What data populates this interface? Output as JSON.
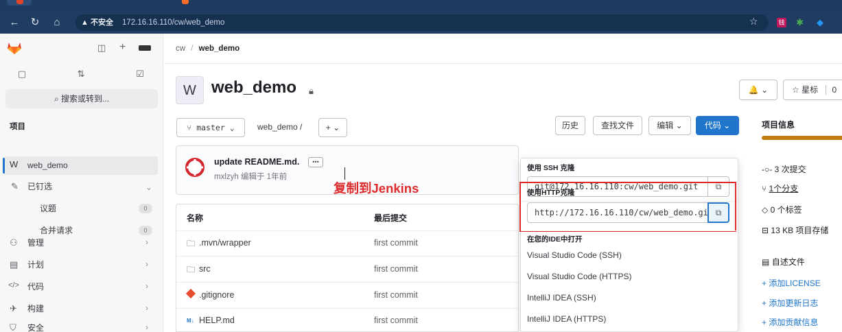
{
  "browser": {
    "warning": "▲ 不安全",
    "url": "172.16.16.110/cw/web_demo",
    "ext1": "钱"
  },
  "sidebar": {
    "search_label": "搜索或转到...",
    "section_heading": "项目",
    "project_badge": "W",
    "project_name": "web_demo",
    "items": [
      {
        "label": "已钉选"
      },
      {
        "label": "议题",
        "count": "0"
      },
      {
        "label": "合并请求",
        "count": "0"
      },
      {
        "label": "管理"
      },
      {
        "label": "计划"
      },
      {
        "label": "代码"
      },
      {
        "label": "构建"
      },
      {
        "label": "安全"
      }
    ]
  },
  "breadcrumb": {
    "group": "cw",
    "project": "web_demo"
  },
  "project": {
    "avatar_letter": "W",
    "name": "web_demo",
    "notify_label": "🔔 ⌄",
    "star_label": "☆ 星标",
    "star_count": "0"
  },
  "toolbar": {
    "branch": "master",
    "path": "web_demo /",
    "add_label": "+",
    "history": "历史",
    "find_file": "查找文件",
    "edit": "编辑",
    "code": "代码"
  },
  "commit": {
    "message": "update README.md.",
    "ellipsis": "•••",
    "author_meta": "mxlzyh 编辑于 1年前"
  },
  "annotation_text": "复制到Jenkins",
  "file_table": {
    "headers": [
      "名称",
      "最后提交"
    ],
    "rows": [
      {
        "name": ".mvn/wrapper",
        "commit": "first commit",
        "icon": "folder-icon"
      },
      {
        "name": "src",
        "commit": "first commit",
        "icon": "folder-icon"
      },
      {
        "name": ".gitignore",
        "commit": "first commit",
        "icon": "git-icon"
      },
      {
        "name": "HELP.md",
        "commit": "first commit",
        "icon": "markdown-icon"
      }
    ]
  },
  "clone_dropdown": {
    "ssh_label": "使用 SSH 克隆",
    "ssh_url": "git@172.16.16.110:cw/web_demo.git",
    "http_label": "使用HTTP克隆",
    "http_url": "http://172.16.16.110/cw/web_demo.git",
    "ide_label": "在您的IDE中打开",
    "ide_items": [
      "Visual Studio Code (SSH)",
      "Visual Studio Code (HTTPS)",
      "IntelliJ IDEA (SSH)",
      "IntelliJ IDEA (HTTPS)"
    ]
  },
  "right_panel": {
    "title": "项目信息",
    "commits": "3 次提交",
    "branches": "1个分支",
    "tags": "0 个标签",
    "storage": "13 KB 项目存储",
    "readme": "自述文件",
    "add_license": "添加LICENSE",
    "add_changelog": "添加更新日志",
    "add_contributing": "添加贡献信息"
  },
  "colors": {
    "accent": "#1f75cb",
    "annotation": "#dd2b2b",
    "language_bar": "#c17d10"
  }
}
